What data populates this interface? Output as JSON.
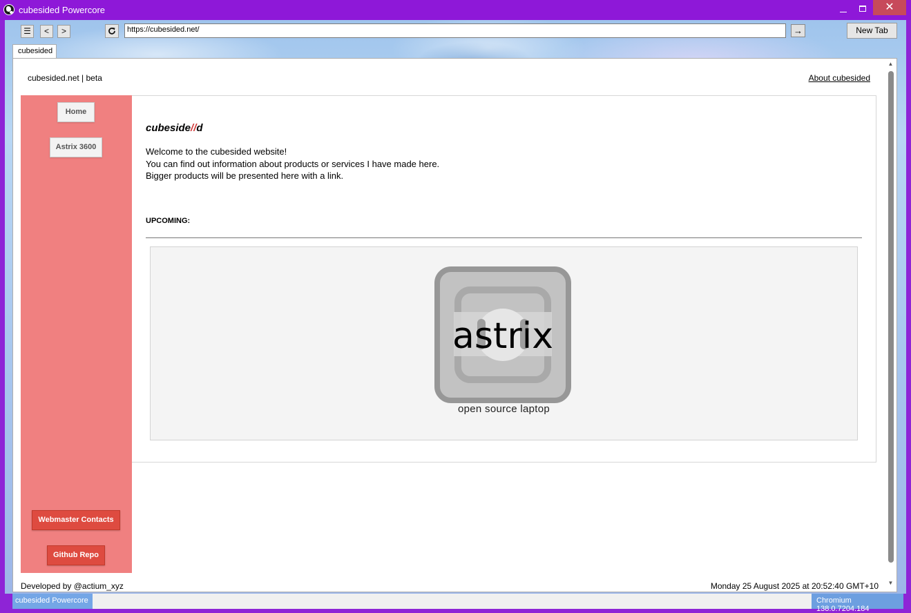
{
  "window": {
    "title": "cubesided Powercore",
    "minimize_glyph": "",
    "maximize_glyph": "",
    "close_glyph": "✕"
  },
  "toolbar": {
    "menu_label": "☰",
    "back_label": "<",
    "forward_label": ">",
    "reload_label": "C",
    "url": "https://cubesided.net/",
    "go_label": "→",
    "new_tab_label": "New Tab"
  },
  "tabs": [
    {
      "label": "cubesided",
      "active": true
    }
  ],
  "page": {
    "brand": "cubesided.net | beta",
    "about_link": "About cubesided",
    "sidebar": {
      "home_label": "Home",
      "astrix_label": "Astrix 3600",
      "contacts_label": "Webmaster Contacts",
      "github_label": "Github Repo",
      "background_color": "#f08080",
      "button_color": "#de4b40"
    },
    "logo": {
      "part1": "cubeside",
      "part2": "//",
      "part3": "d"
    },
    "intro": {
      "line1": "Welcome to the cubesided website!",
      "line2": "You can find out information about products or services I have made here.",
      "line3": "Bigger products will be presented here with a link."
    },
    "upcoming_label": "UPCOMING:",
    "product": {
      "image_word": "astrix",
      "caption": "open source laptop"
    },
    "footer": {
      "left": "Developed by @actium_xyz",
      "right": "Monday 25 August 2025 at 20:52:40 GMT+10"
    }
  },
  "statusbar": {
    "left": "cubesided Powercore",
    "right": "Chromium 138.0.7204.184"
  },
  "colors": {
    "title_bar": "#8e18d8",
    "close_button": "#c74a5b",
    "status_accent": "#74a6e6"
  }
}
